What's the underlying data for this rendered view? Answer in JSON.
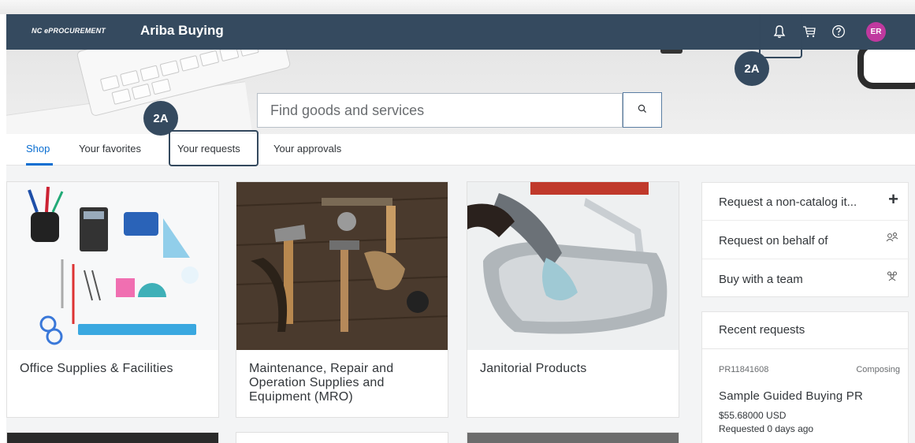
{
  "header": {
    "brand_small": "NC ePROCUREMENT",
    "title": "Ariba Buying",
    "icons": [
      "bell-icon",
      "cart-icon",
      "help-icon"
    ],
    "avatar_initials": "ER",
    "avatar_color": "#c0399f",
    "bar_color": "#354a5f"
  },
  "search": {
    "placeholder": "Find goods and services",
    "button_icon": "search-icon"
  },
  "tabs": [
    {
      "label": "Shop",
      "active": true
    },
    {
      "label": "Your favorites",
      "active": false
    },
    {
      "label": "Your requests",
      "active": false
    },
    {
      "label": "Your approvals",
      "active": false
    }
  ],
  "callouts": {
    "requests_badge": "2A",
    "notifications_badge": "2A"
  },
  "categories": [
    {
      "label": "Office Supplies & Facilities",
      "image": "office-supplies-image"
    },
    {
      "label": "Maintenance, Repair and Operation Supplies and Equipment (MRO)",
      "image": "tools-image"
    },
    {
      "label": "Janitorial Products",
      "image": "sink-cleaning-image"
    }
  ],
  "actions": [
    {
      "label": "Request a non-catalog it...",
      "icon": "plus-icon"
    },
    {
      "label": "Request on behalf of",
      "icon": "person-group-icon"
    },
    {
      "label": "Buy with a team",
      "icon": "team-icon"
    }
  ],
  "recent_requests": {
    "title": "Recent requests",
    "items": [
      {
        "id": "PR11841608",
        "status": "Composing",
        "name": "Sample Guided Buying PR",
        "amount": "$55.68000 USD",
        "requested": "Requested 0 days ago"
      }
    ]
  },
  "colors": {
    "accent": "#0a6ed1",
    "highlight": "#34495e"
  }
}
